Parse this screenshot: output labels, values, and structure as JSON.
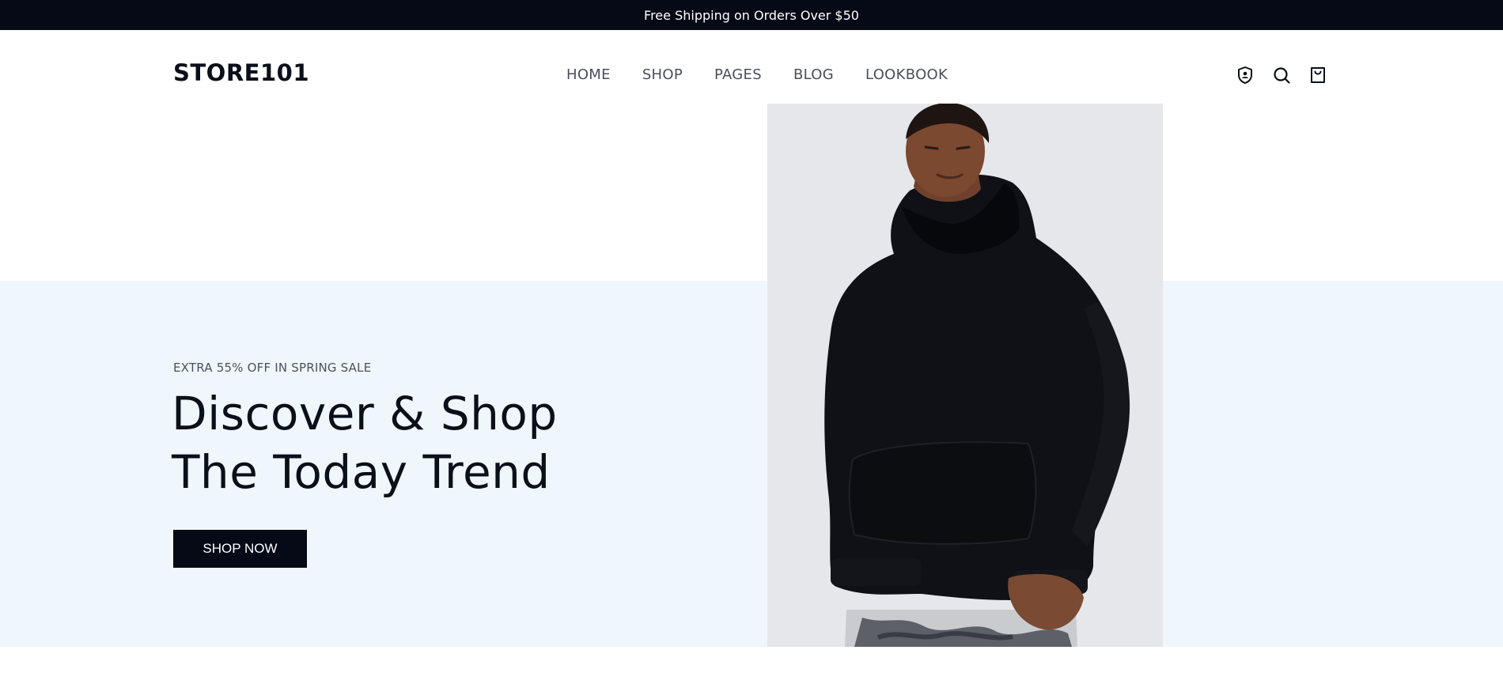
{
  "announcement": {
    "text": "Free Shipping on Orders Over $50"
  },
  "header": {
    "logo": "STORE101",
    "nav": [
      {
        "label": "HOME"
      },
      {
        "label": "SHOP"
      },
      {
        "label": "PAGES"
      },
      {
        "label": "BLOG"
      },
      {
        "label": "LOOKBOOK"
      }
    ],
    "icons": [
      "account-shield-icon",
      "search-icon",
      "cart-bag-icon"
    ]
  },
  "hero": {
    "eyebrow": "EXTRA 55% OFF IN SPRING SALE",
    "headline_line1": "Discover & Shop",
    "headline_line2": "The Today Trend",
    "cta_label": "SHOP NOW",
    "image": "model-black-hoodie"
  },
  "colors": {
    "topbar": "#060a16",
    "hero_bg": "#eff7fc",
    "image_bg": "#e6e7ea",
    "text_dark": "#0b0f1a",
    "nav_text": "#4a4f5c"
  }
}
